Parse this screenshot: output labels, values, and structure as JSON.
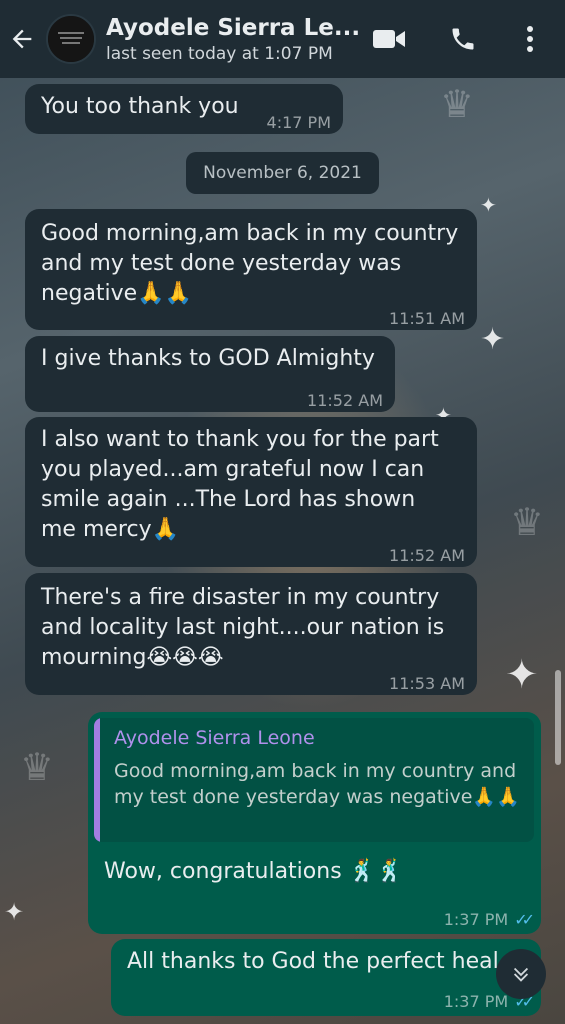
{
  "header": {
    "contact_name": "Ayodele Sierra Le...",
    "last_seen": "last seen today at 1:07 PM",
    "icons": [
      "back-arrow-icon",
      "avatar",
      "video-call-icon",
      "voice-call-icon",
      "more-options-icon"
    ]
  },
  "messages": [
    {
      "direction": "in",
      "text": "You too thank you",
      "time": "4:17 PM"
    },
    {
      "direction": "in",
      "text": "Good morning,am back in my country and my test done yesterday was negative🙏🙏",
      "time": "11:51 AM"
    },
    {
      "direction": "in",
      "text": "I give thanks to GOD  Almighty",
      "time": "11:52 AM"
    },
    {
      "direction": "in",
      "text": "I also want to thank you for the part you played...am grateful now I can smile again ...The Lord has shown me mercy🙏",
      "time": "11:52 AM"
    },
    {
      "direction": "in",
      "text": "There's a fire disaster in my country and locality last night....our nation is mourning😭😭😭",
      "time": "11:53 AM"
    },
    {
      "direction": "out",
      "reply_to": {
        "author": "Ayodele Sierra Leone",
        "text": "Good morning,am back in my country and my test done yesterday was negative🙏🙏"
      },
      "text": "Wow, congratulations 🕺🕺",
      "time": "1:37 PM",
      "status": "read"
    },
    {
      "direction": "out",
      "text": "All thanks to God the perfect heal",
      "time": "1:37 PM",
      "status": "read"
    }
  ],
  "date_divider": "November 6, 2021",
  "colors": {
    "header": "#1f2c34",
    "incoming": "#1f2c34",
    "outgoing": "#005c4b",
    "read_ticks": "#53bdeb",
    "quote_author": "#b091ec"
  }
}
